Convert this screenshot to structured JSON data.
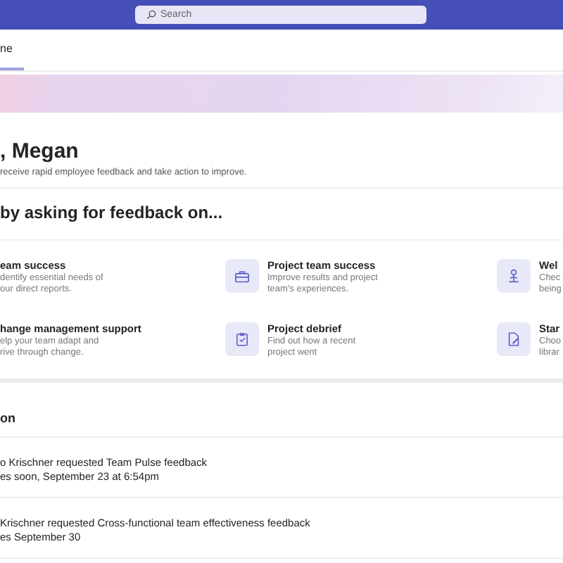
{
  "search": {
    "placeholder": "Search"
  },
  "tabs": [
    {
      "label": "ne",
      "selected": true
    }
  ],
  "greeting": {
    "title": ", Megan",
    "subtitle": "receive rapid employee feedback and take action to improve."
  },
  "feedback_section": {
    "heading": " by asking for feedback on...",
    "cards": [
      {
        "kind": "clipped",
        "title": "eam success",
        "description": [
          "dentify essential needs of",
          "our direct reports."
        ]
      },
      {
        "kind": "full",
        "title": "Project team success",
        "description": [
          "Improve results and project",
          "team's experiences."
        ]
      },
      {
        "kind": "full",
        "title": "Wel",
        "description": [
          "Chec",
          "being"
        ]
      },
      {
        "kind": "clipped",
        "title": "hange management support",
        "description": [
          "elp your team adapt and",
          "rive through change."
        ]
      },
      {
        "kind": "full",
        "title": "Project debrief",
        "description": [
          "Find out how a recent",
          "project went"
        ]
      },
      {
        "kind": "full",
        "title": "Star",
        "description": [
          "Choo",
          "librar"
        ]
      }
    ]
  },
  "requests_section": {
    "heading": "on",
    "items": [
      {
        "title": "o Krischner requested Team Pulse feedback",
        "due": "es soon, September 23 at 6:54pm"
      },
      {
        "title": "Krischner requested Cross-functional team effectiveness feedback",
        "due": "es September 30"
      }
    ]
  }
}
